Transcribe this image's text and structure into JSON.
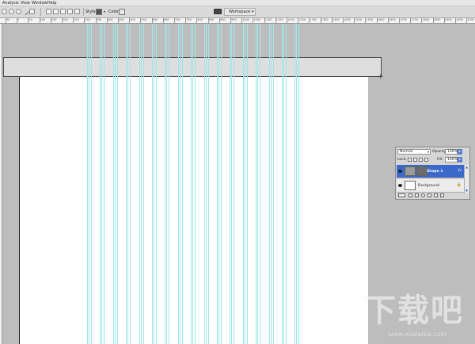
{
  "menu": {
    "items": [
      "Analysis",
      "View",
      "Window",
      "Help"
    ]
  },
  "options_bar": {
    "style_label": "Style:",
    "color_label": "Color:",
    "workspace_label": "Workspace",
    "style_swatch_color": "#555555",
    "color_swatch_color": "#e6e6e6"
  },
  "ruler": {
    "labels": [
      "50",
      "0",
      "50",
      "100",
      "150",
      "200",
      "250",
      "300",
      "350",
      "400",
      "450",
      "500",
      "550",
      "600",
      "650",
      "700",
      "750",
      "800",
      "850",
      "900",
      "950",
      "1000",
      "1050",
      "1100",
      "1150",
      "1200",
      "1250",
      "1300",
      "1350",
      "1400",
      "1450",
      "1500",
      "1550",
      "1600",
      "1650",
      "1700",
      "1750",
      "1800",
      "1850",
      "1900",
      "1950",
      "2000",
      "2050"
    ]
  },
  "layers_panel": {
    "blend_mode": "Normal",
    "opacity_label": "Opacity:",
    "opacity_value": "100%",
    "lock_label": "Lock:",
    "fill_label": "Fill:",
    "fill_value": "100%",
    "layers": [
      {
        "name": "Shape 1",
        "selected": true,
        "row_color": "#3a69c9"
      },
      {
        "name": "Background",
        "selected": false,
        "row_color": "#ececec"
      }
    ]
  },
  "colors": {
    "guide": "#9ee7ea",
    "canvas": "#ffffff",
    "pasteboard": "#bdbdbd",
    "selection": "#3a69c9"
  },
  "watermark": {
    "title": "下载吧",
    "subtitle": "www.xiazaiba.com"
  }
}
